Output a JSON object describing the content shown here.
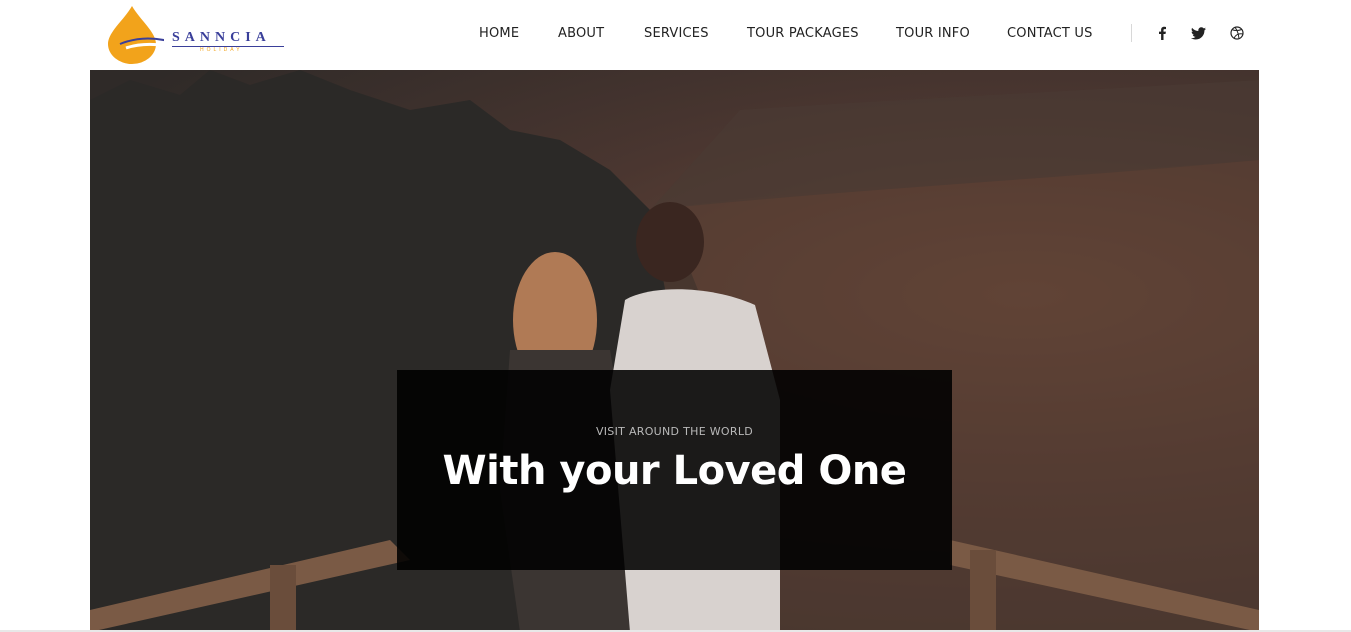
{
  "brand": {
    "name": "SANNCIA",
    "tagline": "HOLIDAY",
    "colors": {
      "drop": "#f2a31b",
      "text": "#3a3f9a"
    }
  },
  "nav": {
    "items": [
      {
        "label": "HOME"
      },
      {
        "label": "ABOUT"
      },
      {
        "label": "SERVICES"
      },
      {
        "label": "TOUR PACKAGES"
      },
      {
        "label": "TOUR INFO"
      },
      {
        "label": "CONTACT US"
      }
    ]
  },
  "social": [
    {
      "icon": "facebook-icon"
    },
    {
      "icon": "twitter-icon"
    },
    {
      "icon": "dribbble-icon"
    }
  ],
  "hero": {
    "subtitle": "VISIT AROUND THE WORLD",
    "title": "With your Loved One"
  }
}
